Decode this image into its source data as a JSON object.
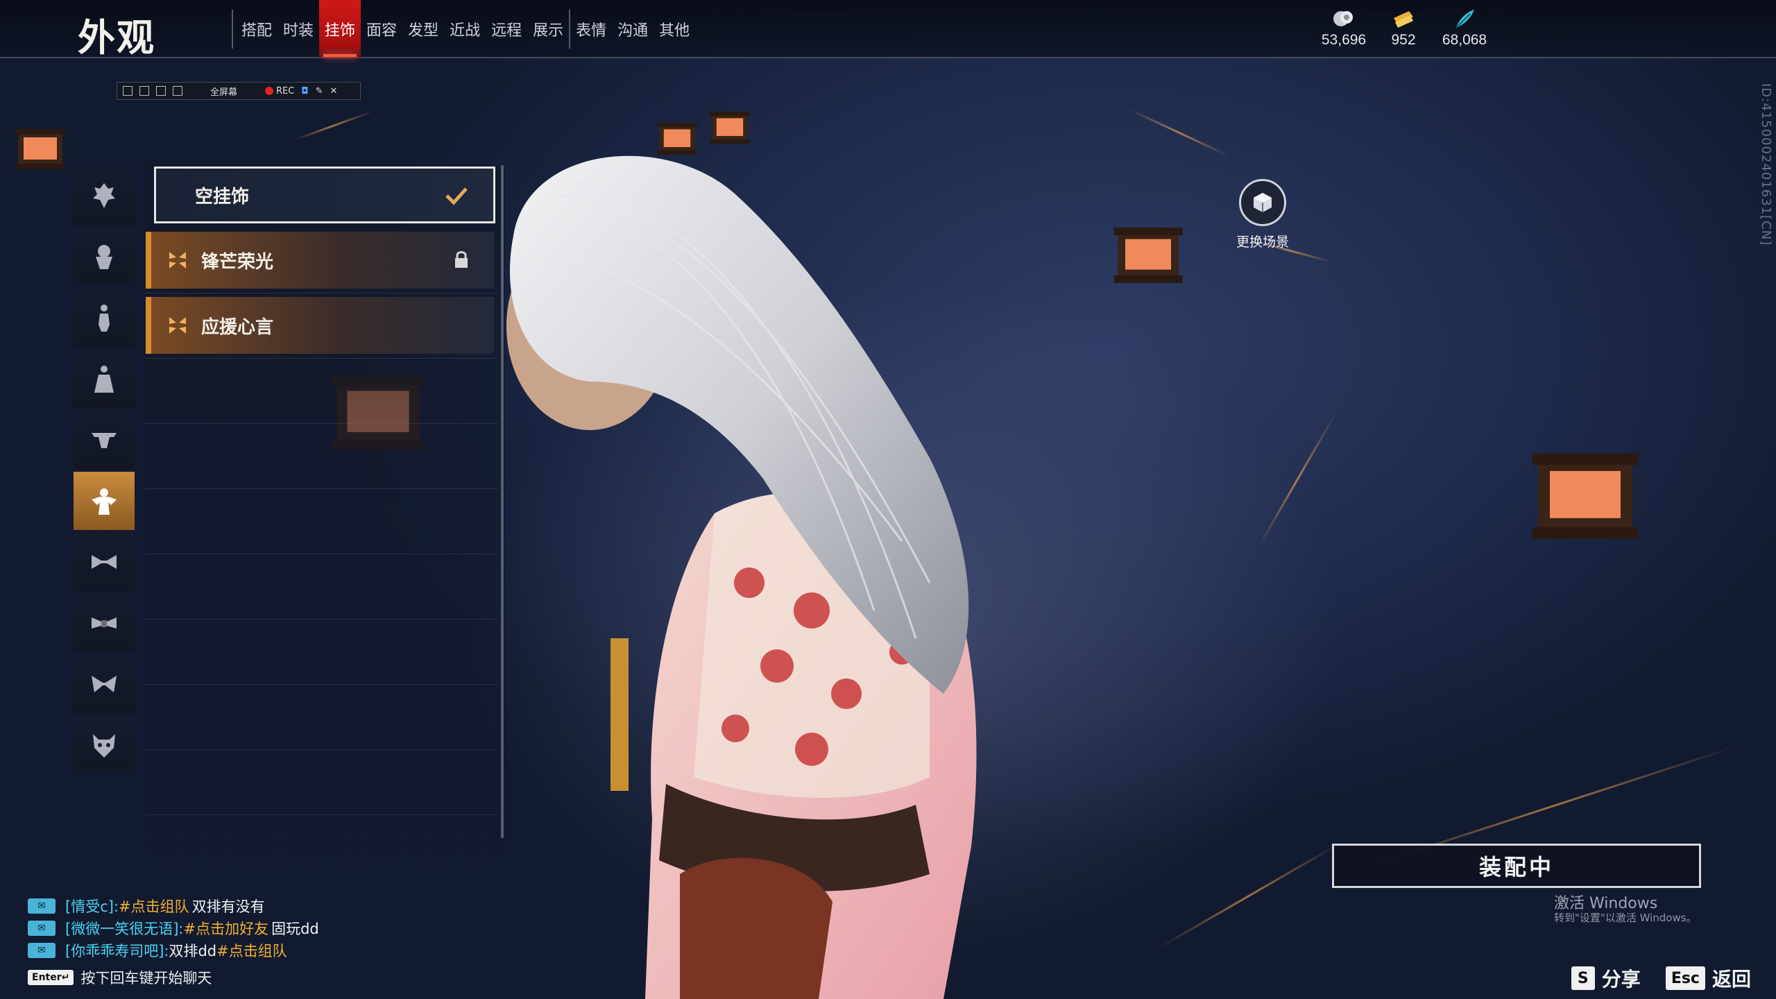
{
  "header": {
    "title": "外观",
    "tabs": [
      {
        "label": "搭配",
        "active": false
      },
      {
        "label": "时装",
        "active": false
      },
      {
        "label": "挂饰",
        "active": true
      },
      {
        "label": "面容",
        "active": false
      },
      {
        "label": "发型",
        "active": false
      },
      {
        "label": "近战",
        "active": false
      },
      {
        "label": "远程",
        "active": false
      },
      {
        "label": "展示",
        "active": false
      },
      {
        "label": "表情",
        "active": false
      },
      {
        "label": "沟通",
        "active": false
      },
      {
        "label": "其他",
        "active": false
      }
    ],
    "currencies": [
      {
        "icon": "coin-icon",
        "value": "53,696"
      },
      {
        "icon": "ticket-icon",
        "value": "952"
      },
      {
        "icon": "feather-icon",
        "value": "68,068"
      }
    ]
  },
  "recorder": {
    "fullscreen_label": "全屏幕",
    "rec_label": "REC"
  },
  "categories": [
    {
      "icon": "category-warrior-icon"
    },
    {
      "icon": "category-head-icon"
    },
    {
      "icon": "category-figure-icon"
    },
    {
      "icon": "category-robe-icon"
    },
    {
      "icon": "category-hat-icon"
    },
    {
      "icon": "category-back-ornament-icon",
      "active": true
    },
    {
      "icon": "category-waist-icon"
    },
    {
      "icon": "category-belt-icon"
    },
    {
      "icon": "category-bow-icon"
    },
    {
      "icon": "category-mask-icon"
    }
  ],
  "items": [
    {
      "label": "空挂饰",
      "state": "selected"
    },
    {
      "label": "锋芒荣光",
      "state": "locked"
    },
    {
      "label": "应援心言",
      "state": "owned"
    }
  ],
  "scene": {
    "label": "更换场景"
  },
  "vertical_id": "ID:4150002401631[CN]",
  "equip": {
    "label": "装配中"
  },
  "windows_notice": {
    "title": "激活 Windows",
    "subtitle": "转到\"设置\"以激活 Windows。"
  },
  "chat": {
    "lines": [
      {
        "name": "[情受c]:",
        "action": "#点击组队",
        "msg": "双排有没有"
      },
      {
        "name": "[微微一笑很无语]:",
        "action": "#点击加好友",
        "msg": "固玩dd"
      },
      {
        "name": "[你乖乖寿司吧]:",
        "msg_pre": "双排dd",
        "action": "#点击组队"
      }
    ],
    "hint_key": "Enter↵",
    "hint": "按下回车键开始聊天"
  },
  "footer": {
    "share_key": "S",
    "share_label": "分享",
    "back_key": "Esc",
    "back_label": "返回"
  }
}
